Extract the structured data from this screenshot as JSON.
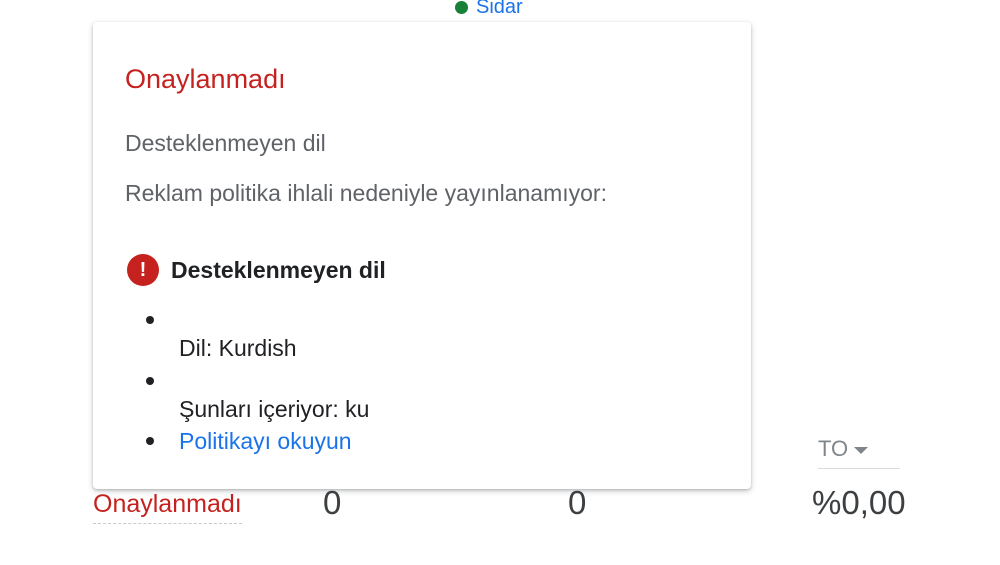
{
  "top": {
    "label": "Sidar",
    "dot_color": "#188038"
  },
  "popover": {
    "title": "Onaylanmadı",
    "line1": "Desteklenmeyen dil",
    "line2": "Reklam politika ihlali nedeniyle yayınlanamıyor:",
    "issue": {
      "icon": "error-icon",
      "icon_glyph": "!",
      "title": "Desteklenmeyen dil"
    },
    "items": [
      "Dil: Kurdish",
      "Şunları içeriyor: ku"
    ],
    "link": "Politikayı okuyun"
  },
  "row": {
    "status": "Onaylanmadı",
    "val1": "0",
    "val2": "0",
    "val3": "%0,00"
  },
  "select": {
    "value": "TO"
  },
  "colors": {
    "status_red": "#c5221f",
    "link_blue": "#1a73e8",
    "green": "#188038"
  }
}
